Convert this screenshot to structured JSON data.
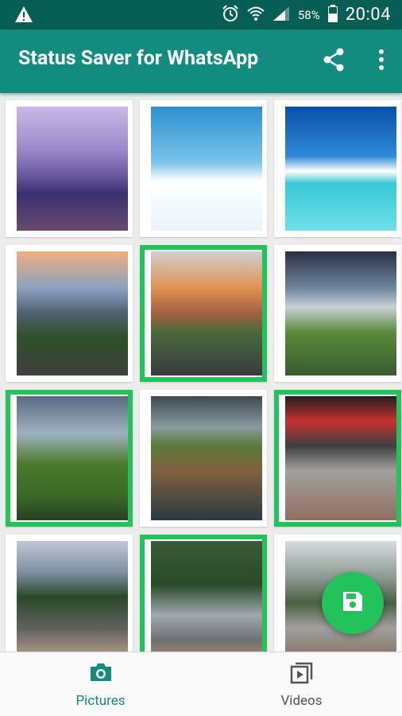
{
  "status_bar": {
    "battery": "58%",
    "time": "20:04"
  },
  "app_bar": {
    "title": "Status Saver for WhatsApp"
  },
  "bottom_nav": {
    "pictures_label": "Pictures",
    "videos_label": "Videos"
  },
  "grid": [
    {
      "name": "taj-mahal-lanterns-thumbnail",
      "selected": false,
      "scene": "taj"
    },
    {
      "name": "palm-tree-beach-thumbnail",
      "selected": false,
      "scene": "palm"
    },
    {
      "name": "tropical-island-thumbnail",
      "selected": false,
      "scene": "island"
    },
    {
      "name": "mountain-road-thumbnail",
      "selected": false,
      "scene": "mountain"
    },
    {
      "name": "desert-road-thumbnail",
      "selected": true,
      "scene": "road"
    },
    {
      "name": "coastal-cliff-thumbnail",
      "selected": false,
      "scene": "cliff"
    },
    {
      "name": "green-cliff-sea-thumbnail",
      "selected": true,
      "scene": "cliff2"
    },
    {
      "name": "waterfall-cliff-thumbnail",
      "selected": false,
      "scene": "falls"
    },
    {
      "name": "silver-suv-garage-thumbnail",
      "selected": true,
      "scene": "garage"
    },
    {
      "name": "suv-and-sports-car-thumbnail",
      "selected": false,
      "scene": "cars"
    },
    {
      "name": "sports-car-rear-thumbnail",
      "selected": true,
      "scene": "porsche"
    },
    {
      "name": "sports-car-street-thumbnail",
      "selected": false,
      "scene": "street"
    }
  ],
  "colors": {
    "status_bar": "#075e54",
    "app_bar": "#128c7e",
    "accent": "#21c35a",
    "active_nav": "#128c7e",
    "inactive_nav": "#555555"
  },
  "icons": [
    "warning-icon",
    "alarm-icon",
    "wifi-icon",
    "signal-icon",
    "battery-icon",
    "share-icon",
    "more-vert-icon",
    "save-icon",
    "camera-icon",
    "video-library-icon"
  ]
}
